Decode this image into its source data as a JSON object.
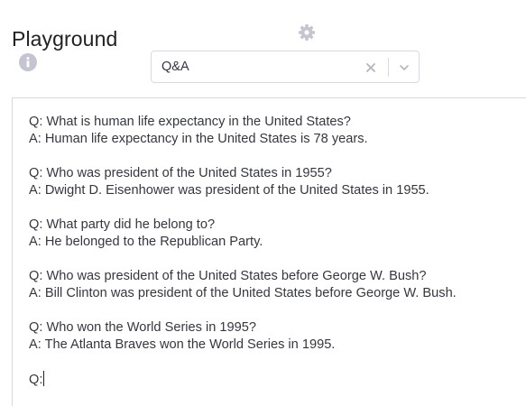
{
  "header": {
    "title": "Playground"
  },
  "preset": {
    "selected": "Q&A"
  },
  "prompt": {
    "pairs": [
      {
        "q": "Q: What is human life expectancy in the United States?",
        "a": "A: Human life expectancy in the United States is 78 years."
      },
      {
        "q": "Q: Who was president of the United States in 1955?",
        "a": "A: Dwight D. Eisenhower was president of the United States in 1955."
      },
      {
        "q": "Q: What party did he belong to?",
        "a": "A: He belonged to the Republican Party."
      },
      {
        "q": "Q: Who was president of the United States before George W. Bush?",
        "a": "A: Bill Clinton was president of the United States before George W. Bush."
      },
      {
        "q": "Q: Who won the World Series in 1995?",
        "a": "A: The Atlanta Braves won the World Series in 1995."
      }
    ],
    "final_prefix": "Q:"
  },
  "icons": {
    "info": "info-icon",
    "settings": "gear-icon",
    "clear": "close-icon",
    "dropdown": "chevron-down-icon"
  },
  "colors": {
    "icon_gray": "#c5c5d2",
    "border": "#d9d9e3",
    "text": "#353740"
  }
}
